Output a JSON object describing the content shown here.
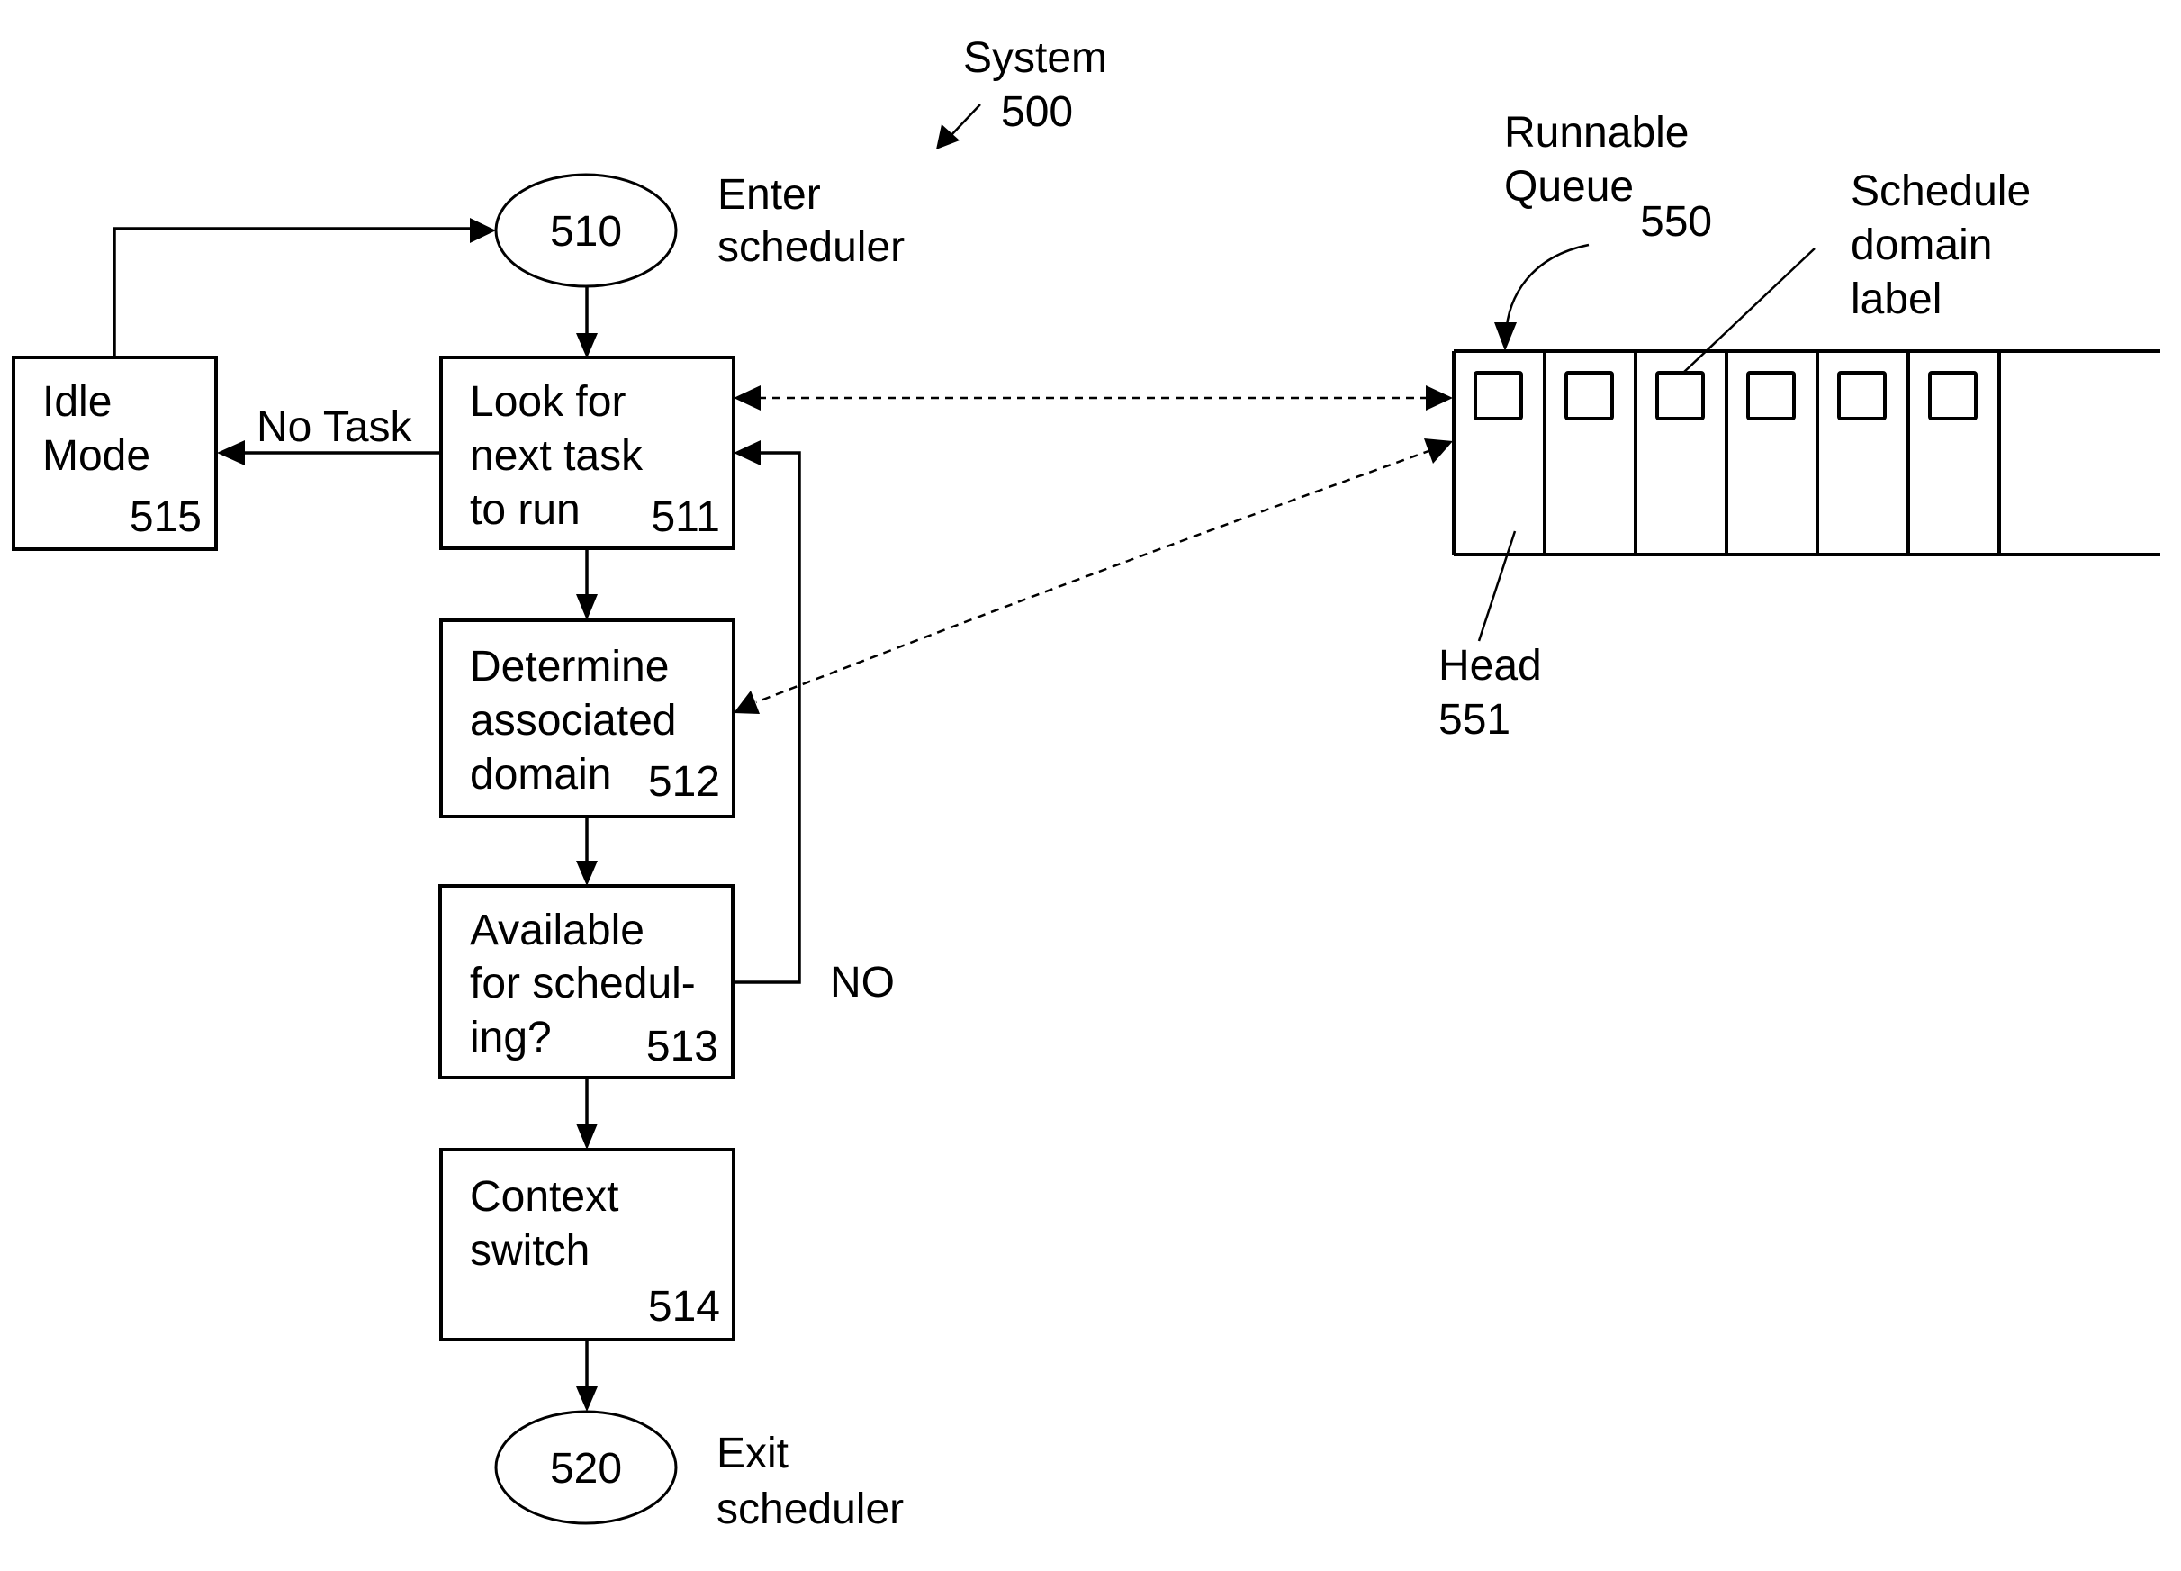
{
  "figure": {
    "system_label": "System",
    "system_number": "500"
  },
  "nodes": {
    "enter": {
      "number": "510",
      "caption": [
        "Enter",
        "scheduler"
      ]
    },
    "look_for_task": {
      "lines": [
        "Look for",
        "next task",
        "to run"
      ],
      "number": "511"
    },
    "determine_domain": {
      "lines": [
        "Determine",
        "associated",
        "domain"
      ],
      "number": "512"
    },
    "available": {
      "lines": [
        "Available",
        "for schedul-",
        "ing?"
      ],
      "number": "513"
    },
    "context_switch": {
      "lines": [
        "Context",
        "switch"
      ],
      "number": "514"
    },
    "idle_mode": {
      "lines": [
        "Idle",
        "Mode"
      ],
      "number": "515"
    },
    "exit": {
      "number": "520",
      "caption": [
        "Exit",
        "scheduler"
      ]
    }
  },
  "edges": {
    "no_task_label": "No Task",
    "no_label": "NO"
  },
  "queue": {
    "title_lines": [
      "Runnable",
      "Queue"
    ],
    "number": "550",
    "cell_count": 6,
    "domain_label_lines": [
      "Schedule",
      "domain",
      "label"
    ],
    "head_label": "Head",
    "head_number": "551"
  }
}
